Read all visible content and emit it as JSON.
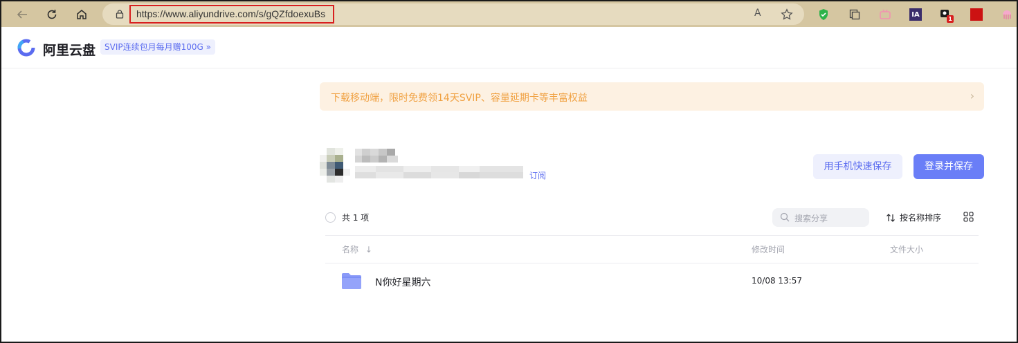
{
  "browser": {
    "url": "https://www.aliyundrive.com/s/gQZfdoexuBs",
    "read_aloud_label": "A",
    "extensions": [
      {
        "name": "shield-extension",
        "color": "#2db34a"
      },
      {
        "name": "collections-extension",
        "color": "#555555"
      },
      {
        "name": "bilibili-extension",
        "color": "#f48fb1"
      },
      {
        "name": "ia-extension",
        "label": "IA",
        "color": "#3b2d6b"
      },
      {
        "name": "notification-extension",
        "badge": "1",
        "color": "#d81f1f"
      },
      {
        "name": "red-extension",
        "color": "#cc1212"
      },
      {
        "name": "jellyfish-extension",
        "color": "#f06aa9"
      }
    ]
  },
  "app": {
    "name": "阿里云盘",
    "promo": "SVIP连续包月每月赠100G »",
    "brand_color": "#5b6cf0"
  },
  "banner": {
    "text": "下载移动端，限时免费领14天SVIP、容量延期卡等丰富权益",
    "arrow": "›"
  },
  "share": {
    "subscribe_label": "订阅",
    "save_by_phone_label": "用手机快速保存",
    "login_save_label": "登录并保存"
  },
  "list": {
    "count_label": "共 1 项",
    "search_placeholder": "搜索分享",
    "sort_label": "按名称排序",
    "columns": {
      "name": "名称",
      "modified": "修改时间",
      "size": "文件大小"
    },
    "rows": [
      {
        "name": "N你好星期六",
        "modified": "10/08 13:57",
        "size": ""
      }
    ]
  }
}
